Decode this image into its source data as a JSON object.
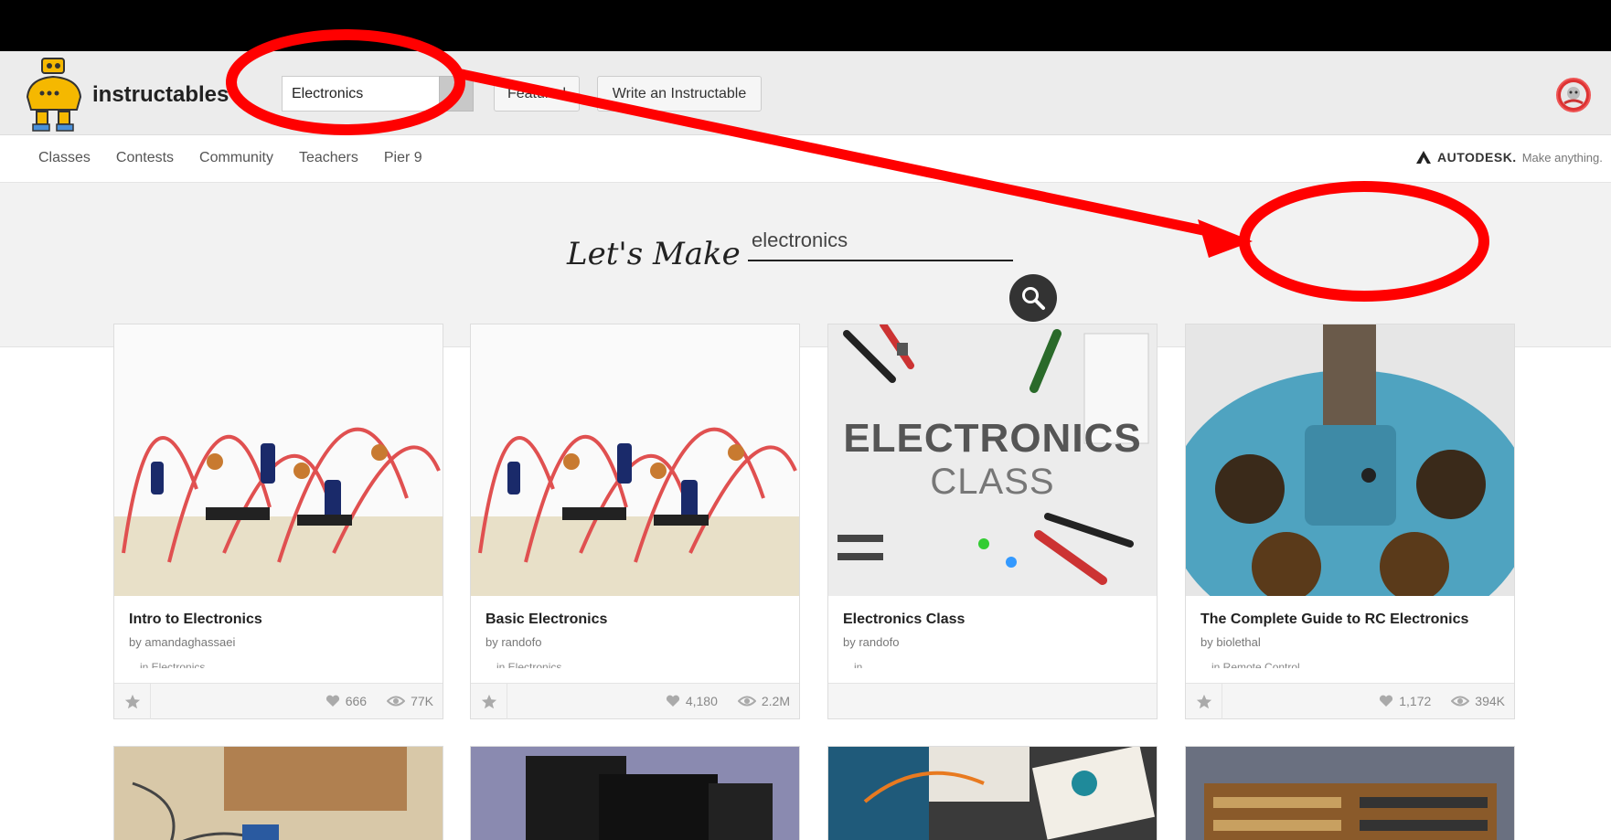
{
  "header": {
    "brand": "instructables",
    "search_value": "Electronics",
    "featured_label": "Featured",
    "write_label": "Write an Instructable"
  },
  "nav": {
    "links": [
      "Classes",
      "Contests",
      "Community",
      "Teachers",
      "Pier 9"
    ],
    "autodesk_brand": "AUTODESK.",
    "autodesk_tagline": "Make anything."
  },
  "hero": {
    "heading": "Let's Make",
    "input_value": "electronics"
  },
  "cards": [
    {
      "title": "Intro to Electronics",
      "author": "by amandaghassaei",
      "category": "in Electronics",
      "likes": "666",
      "views": "77K"
    },
    {
      "title": "Basic Electronics",
      "author": "by randofo",
      "category": "in Electronics",
      "likes": "4,180",
      "views": "2.2M"
    },
    {
      "title": "Electronics Class",
      "author": "by randofo",
      "category": "in",
      "likes": "",
      "views": "",
      "thumb_title": "ELECTRONICS",
      "thumb_subtitle": "CLASS"
    },
    {
      "title": "The Complete Guide to RC Electronics",
      "author": "by biolethal",
      "category": "in Remote Control",
      "likes": "1,172",
      "views": "394K"
    }
  ],
  "colors": {
    "annotation_red": "#ff0000",
    "logo_yellow": "#f5b800"
  }
}
